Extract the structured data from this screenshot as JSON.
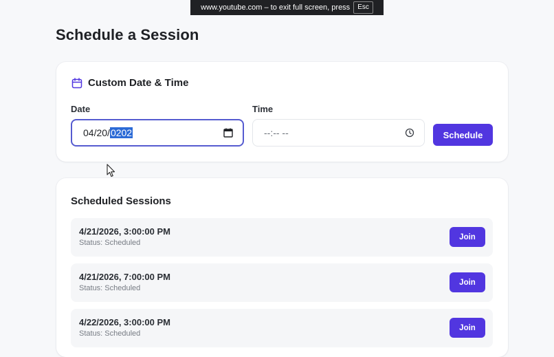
{
  "banner": {
    "text": "www.youtube.com – to exit full screen, press",
    "key": "Esc"
  },
  "page": {
    "title": "Schedule a Session"
  },
  "custom": {
    "title": "Custom Date & Time",
    "icon": "calendar-icon",
    "date_label": "Date",
    "date_value_prefix": "04/20/",
    "date_value_selected": "0202",
    "time_label": "Time",
    "time_placeholder": "--:-- --",
    "schedule_label": "Schedule"
  },
  "sessions": {
    "title": "Scheduled Sessions",
    "items": [
      {
        "when": "4/21/2026, 3:00:00 PM",
        "status": "Status: Scheduled",
        "action": "Join"
      },
      {
        "when": "4/21/2026, 7:00:00 PM",
        "status": "Status: Scheduled",
        "action": "Join"
      },
      {
        "when": "4/22/2026, 3:00:00 PM",
        "status": "Status: Scheduled",
        "action": "Join"
      }
    ]
  },
  "colors": {
    "accent": "#5136e0",
    "focus_border": "#555bd0",
    "selection": "#2b6ad6",
    "background": "#f7f8fa"
  }
}
